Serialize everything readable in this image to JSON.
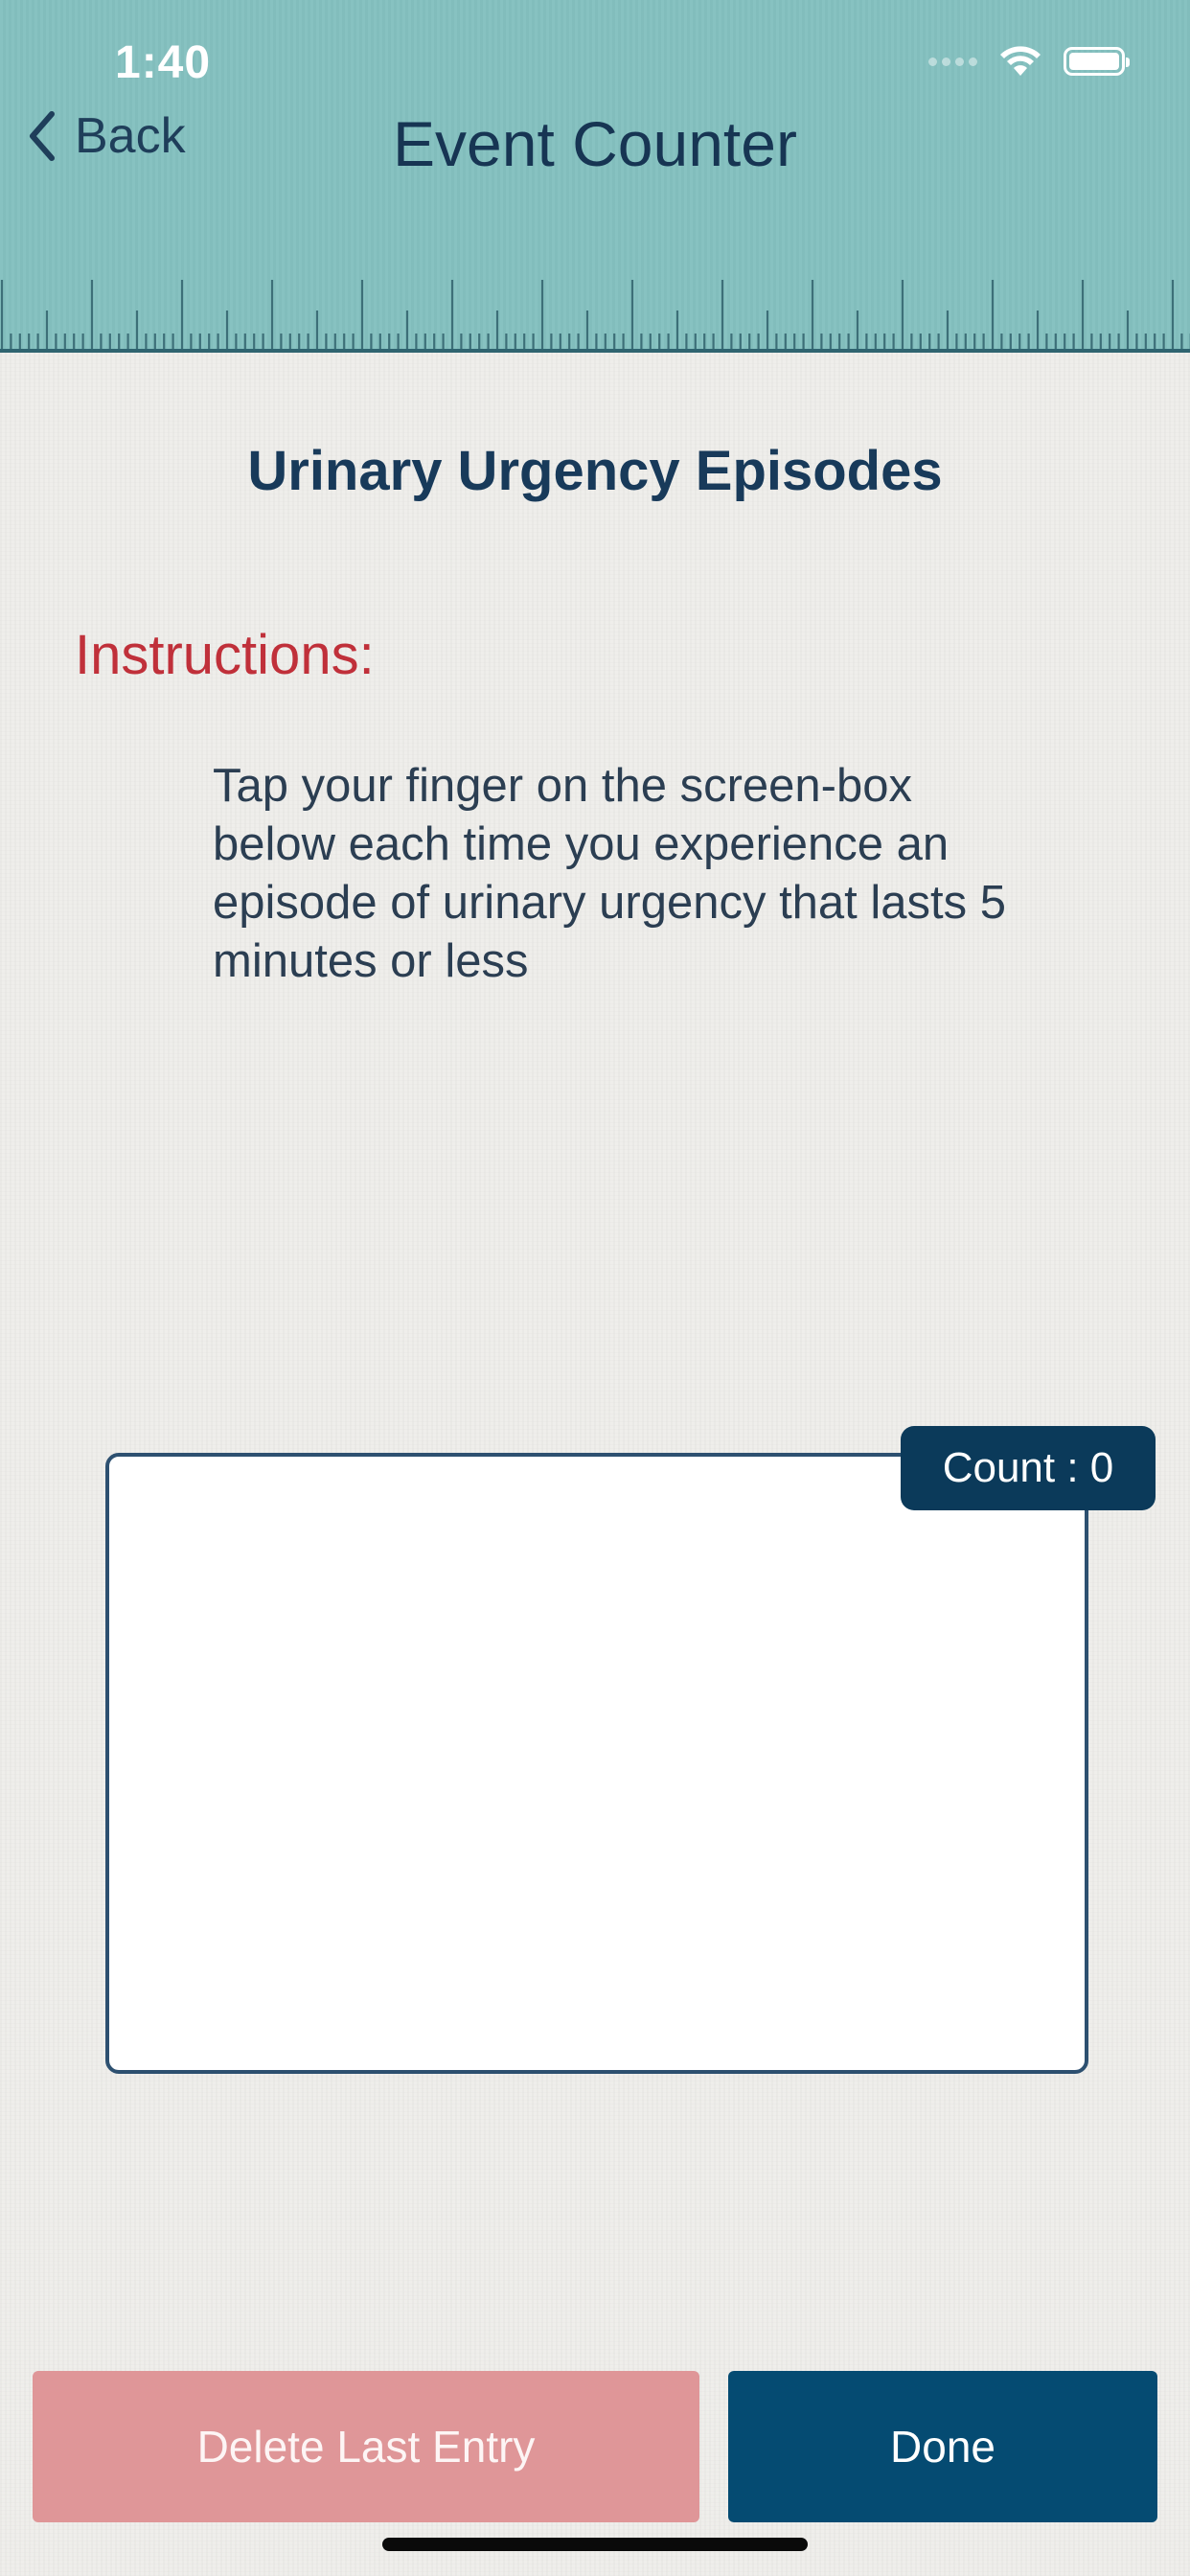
{
  "status_bar": {
    "time": "1:40"
  },
  "nav": {
    "back_label": "Back",
    "title": "Event Counter"
  },
  "content": {
    "title": "Urinary Urgency Episodes",
    "instructions_heading": "Instructions:",
    "instructions_body": "Tap your finger on the screen-box below each time you experience an episode of urinary urgency that lasts 5 minutes or less"
  },
  "counter": {
    "label": "Count : 0"
  },
  "actions": {
    "delete_label": "Delete Last Entry",
    "done_label": "Done"
  },
  "colors": {
    "header": "#84c1c0",
    "heading_red": "#c0303a",
    "navy": "#0b3a5a",
    "done_button": "#054b72",
    "delete_button": "#df9698"
  },
  "icons": [
    "back-chevron-icon",
    "cellular-signal-icon",
    "wifi-icon",
    "battery-icon"
  ]
}
